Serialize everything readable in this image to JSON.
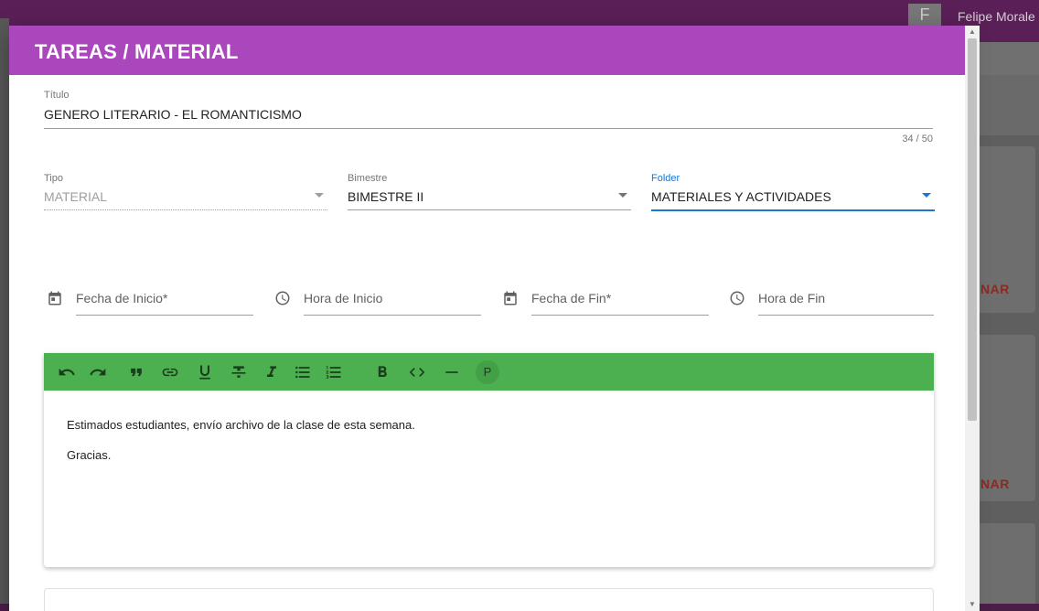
{
  "background": {
    "user_name": "Felipe Morale",
    "user_avatar_letter": "F",
    "card_button_label": "NAR"
  },
  "dialog": {
    "title": "TAREAS / MATERIAL",
    "header_color": "#ab47bc",
    "titulo": {
      "label": "Título",
      "value": "GENERO LITERARIO - EL ROMANTICISMO",
      "counter": "34 / 50"
    },
    "tipo": {
      "label": "Tipo",
      "value": "MATERIAL"
    },
    "bimestre": {
      "label": "Bimestre",
      "value": "BIMESTRE II"
    },
    "folder": {
      "label": "Folder",
      "value": "MATERIALES Y ACTIVIDADES"
    },
    "fecha_inicio": {
      "label": "Fecha de Inicio*",
      "icon": "calendar-icon"
    },
    "hora_inicio": {
      "label": "Hora de Inicio",
      "icon": "clock-icon"
    },
    "fecha_fin": {
      "label": "Fecha de Fin*",
      "icon": "calendar-icon"
    },
    "hora_fin": {
      "label": "Hora de Fin",
      "icon": "clock-icon"
    }
  },
  "editor": {
    "toolbar_color": "#4caf50",
    "toolbar": [
      "undo-icon",
      "redo-icon",
      "blockquote-icon",
      "link-icon",
      "underline-icon",
      "strikethrough-icon",
      "italic-icon",
      "bullet-list-icon",
      "ordered-list-icon",
      "bold-icon",
      "code-icon",
      "horizontal-rule-icon",
      "paragraph-icon"
    ],
    "paragraph_button_label": "P",
    "content": [
      "Estimados estudiantes, envío archivo de la clase de esta semana.",
      "Gracias."
    ]
  }
}
